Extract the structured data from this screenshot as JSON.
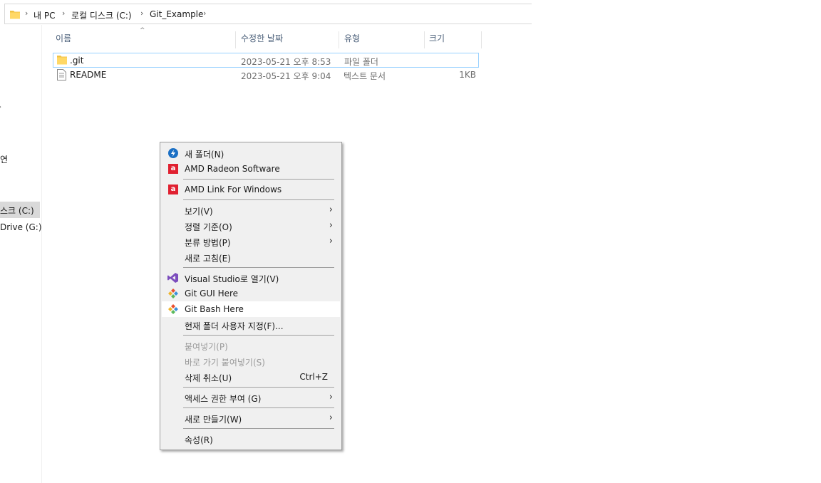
{
  "address": {
    "crumbs": [
      "내 PC",
      "로컬 디스크 (C:)",
      "Git_Example"
    ]
  },
  "nav": {
    "items": [
      "연",
      "스크 (C:)",
      "Drive (G:)"
    ]
  },
  "columns": [
    "이름",
    "수정한 날짜",
    "유형",
    "크기"
  ],
  "files": [
    {
      "name": ".git",
      "date": "2023-05-21 오후 8:53",
      "type": "파일 폴더",
      "size": "",
      "icon": "folder-icon"
    },
    {
      "name": "README",
      "date": "2023-05-21 오후 9:04",
      "type": "텍스트 문서",
      "size": "1KB",
      "icon": "text-file-icon"
    }
  ],
  "menu": {
    "new_folder": "새 폴더(N)",
    "amd_radeon": "AMD Radeon Software",
    "amd_link": "AMD Link For Windows",
    "view": "보기(V)",
    "sort": "정렬 기준(O)",
    "group": "분류 방법(P)",
    "refresh": "새로 고침(E)",
    "open_vs": "Visual Studio로 열기(V)",
    "git_gui": "Git GUI Here",
    "git_bash": "Git Bash Here",
    "customize": "현재 폴더 사용자 지정(F)...",
    "paste": "붙여넣기(P)",
    "paste_shortcut": "바로 가기 붙여넣기(S)",
    "undo_delete": "삭제 취소(U)",
    "undo_shortcut": "Ctrl+Z",
    "access": "액세스 권한 부여 (G)",
    "new": "새로 만들기(W)",
    "properties": "속성(R)"
  }
}
